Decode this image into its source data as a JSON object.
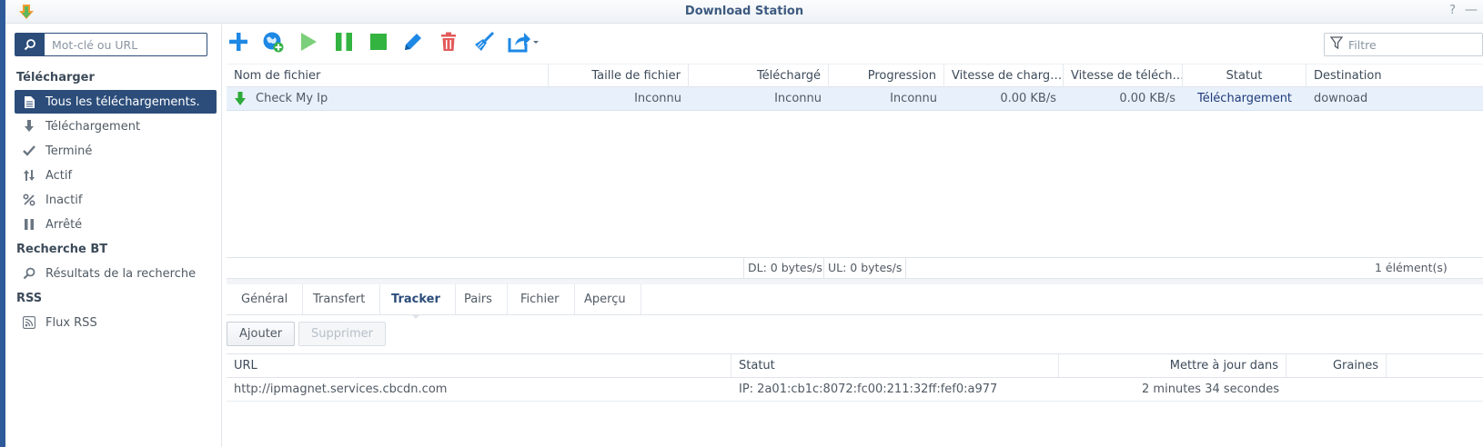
{
  "window": {
    "title": "Download Station",
    "help_label": "?",
    "minimize_label": "—"
  },
  "sidebar": {
    "search": {
      "placeholder": "Mot-clé ou URL"
    },
    "sections": [
      {
        "label": "Télécharger"
      },
      {
        "label": "Recherche BT"
      },
      {
        "label": "RSS"
      }
    ],
    "items": [
      {
        "label": "Tous les téléchargements.",
        "icon": "document-icon",
        "active": true
      },
      {
        "label": "Téléchargement",
        "icon": "arrow-down-icon"
      },
      {
        "label": "Terminé",
        "icon": "checkmark-icon"
      },
      {
        "label": "Actif",
        "icon": "up-down-arrows-icon"
      },
      {
        "label": "Inactif",
        "icon": "percent-icon"
      },
      {
        "label": "Arrêté",
        "icon": "pause-icon"
      },
      {
        "label": "Résultats de la recherche",
        "icon": "magnifier-icon"
      },
      {
        "label": "Flux RSS",
        "icon": "rss-icon"
      }
    ]
  },
  "toolbar": {
    "buttons": [
      {
        "name": "add",
        "icon": "plus-icon",
        "color": "#1e88e5"
      },
      {
        "name": "add-url",
        "icon": "globe-plus-icon",
        "color": "#1e88e5"
      },
      {
        "name": "resume",
        "icon": "play-icon",
        "color": "#7ccf7a"
      },
      {
        "name": "pause",
        "icon": "pause-icon",
        "color": "#33b33f"
      },
      {
        "name": "stop",
        "icon": "stop-icon",
        "color": "#33b33f"
      },
      {
        "name": "edit",
        "icon": "pencil-icon",
        "color": "#1e88e5"
      },
      {
        "name": "delete",
        "icon": "trash-icon",
        "color": "#e35a5a"
      },
      {
        "name": "clear",
        "icon": "broom-icon",
        "color": "#1e88e5"
      },
      {
        "name": "share",
        "icon": "share-icon",
        "color": "#1e88e5"
      }
    ],
    "filter": {
      "placeholder": "Filtre"
    }
  },
  "downloads": {
    "columns": [
      "Nom de fichier",
      "Taille de fichier",
      "Téléchargé",
      "Progression",
      "Vitesse de charg…",
      "Vitesse de téléch…",
      "Statut",
      "Destination"
    ],
    "rows": [
      {
        "name": "Check My Ip",
        "size": "Inconnu",
        "downloaded": "Inconnu",
        "progress": "Inconnu",
        "upload_speed": "0.00 KB/s",
        "download_speed": "0.00 KB/s",
        "status": "Téléchargement",
        "destination": "downoad"
      }
    ],
    "status_bar": {
      "dl": "DL:  0 bytes/s",
      "ul": "UL:  0 bytes/s",
      "count": "1 élément(s)"
    }
  },
  "detail": {
    "tabs": [
      {
        "label": "Général"
      },
      {
        "label": "Transfert"
      },
      {
        "label": "Tracker",
        "active": true
      },
      {
        "label": "Pairs"
      },
      {
        "label": "Fichier"
      },
      {
        "label": "Aperçu"
      }
    ],
    "buttons": {
      "add": "Ajouter",
      "remove": "Supprimer"
    },
    "tracker": {
      "columns": [
        "URL",
        "Statut",
        "Mettre à jour dans",
        "Graines"
      ],
      "rows": [
        {
          "url": "http://ipmagnet.services.cbcdn.com",
          "status": "IP: 2a01:cb1c:8072:fc00:211:32ff:fef0:a977",
          "update_in": "2 minutes 34 secondes",
          "seeds": ""
        }
      ]
    }
  },
  "colors": {
    "accent": "#2c4d7a",
    "selected_row": "#e8f1fb",
    "status_link": "#1f3a7a"
  }
}
